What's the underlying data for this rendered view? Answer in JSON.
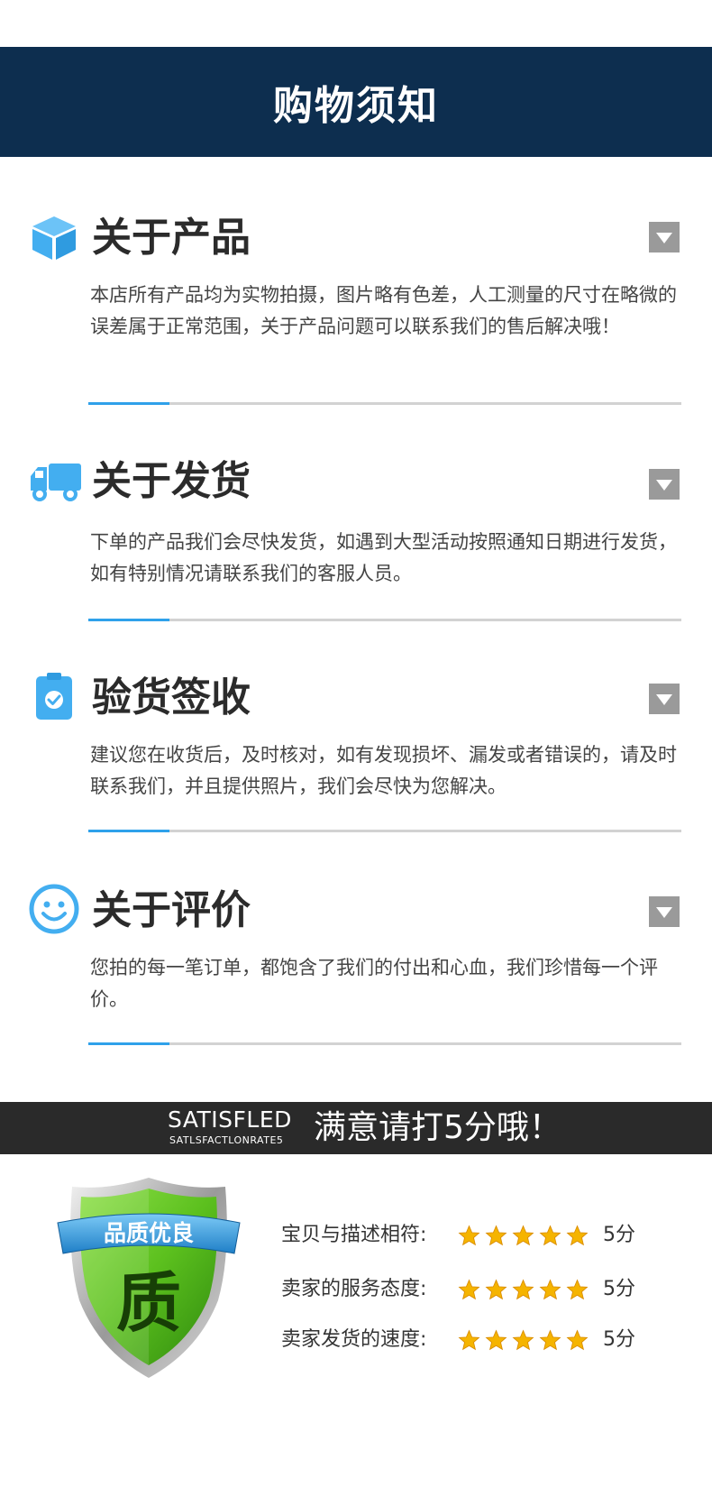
{
  "header": {
    "title": "购物须知"
  },
  "sections": [
    {
      "title": "关于产品",
      "icon": "box-icon",
      "body": "本店所有产品均为实物拍摄，图片略有色差，人工测量的尺寸在略微的误差属于正常范围，关于产品问题可以联系我们的售后解决哦！"
    },
    {
      "title": "关于发货",
      "icon": "truck-icon",
      "body": "下单的产品我们会尽快发货，如遇到大型活动按照通知日期进行发货，如有特别情况请联系我们的客服人员。"
    },
    {
      "title": "验货签收",
      "icon": "clipboard-check-icon",
      "body": "建议您在收货后，及时核对，如有发现损坏、漏发或者错误的，请及时联系我们，并且提供照片，我们会尽快为您解决。"
    },
    {
      "title": "关于评价",
      "icon": "smiley-icon",
      "body": "您拍的每一笔订单，都饱含了我们的付出和心血，我们珍惜每一个评价。"
    }
  ],
  "banner": {
    "en_title": "SATISFLED",
    "en_sub": "SATLSFACTLONRATE5",
    "cn_title": "满意请打5分哦！"
  },
  "badge": {
    "ribbon_text": "品质优良",
    "center_char": "质"
  },
  "ratings": [
    {
      "label": "宝贝与描述相符:",
      "stars": 5,
      "score": "5分"
    },
    {
      "label": "卖家的服务态度:",
      "stars": 5,
      "score": "5分"
    },
    {
      "label": "卖家发货的速度:",
      "stars": 5,
      "score": "5分"
    }
  ],
  "colors": {
    "header_bg": "#0d2e4f",
    "icon_blue": "#43aef0",
    "accent_line": "#2fa1ea",
    "toggle_gray": "#9a9a9a",
    "banner_bg": "#2a2a2a",
    "star_gold": "#f5b400",
    "shield_green": "#5cc01e"
  }
}
